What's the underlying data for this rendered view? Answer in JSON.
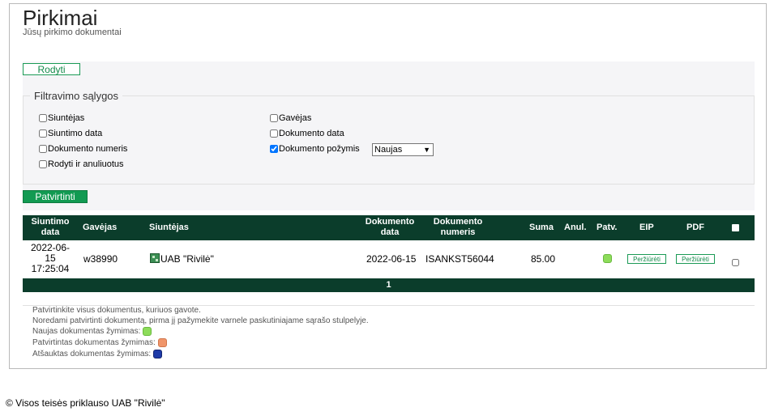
{
  "page": {
    "title": "Pirkimai",
    "subtitle": "Jūsų pirkimo dokumentai"
  },
  "buttons": {
    "show": "Rodyti",
    "confirm": "Patvirtinti"
  },
  "filters": {
    "legend": "Filtravimo sąlygos",
    "sender": {
      "label": "Siuntėjas",
      "checked": false
    },
    "sent_date": {
      "label": "Siuntimo data",
      "checked": false
    },
    "doc_number": {
      "label": "Dokumento numeris",
      "checked": false
    },
    "show_cancelled": {
      "label": "Rodyti ir anuliuotus",
      "checked": false
    },
    "receiver": {
      "label": "Gavėjas",
      "checked": false
    },
    "doc_date": {
      "label": "Dokumento data",
      "checked": false
    },
    "doc_feature": {
      "label": "Dokumento požymis",
      "checked": true,
      "selected": "Naujas"
    }
  },
  "table": {
    "headers": {
      "sent_date": [
        "Siuntimo",
        "data"
      ],
      "receiver": "Gavėjas",
      "sender": "Siuntėjas",
      "doc_date": [
        "Dokumento",
        "data"
      ],
      "doc_number": [
        "Dokumento",
        "numeris"
      ],
      "sum": "Suma",
      "cancelled": "Anul.",
      "confirmed": "Patv.",
      "eip": "EIP",
      "pdf": "PDF"
    },
    "rows": [
      {
        "sent_date": [
          "2022-06-",
          "15",
          "17:25:04"
        ],
        "receiver": "w38990",
        "sender": "UAB \"Rivilė\"",
        "sender_icon": "rivile-logo-icon",
        "doc_date": "2022-06-15",
        "doc_number": "ISANKST56044",
        "sum": "85.00",
        "cancelled": "",
        "status": "new",
        "eip_link": "Peržiūrėti",
        "pdf_link": "Peržiūrėti",
        "selected": false
      }
    ],
    "pager": "1"
  },
  "notes": {
    "line1": "Patvirtinkite visus dokumentus, kuriuos gavote.",
    "line2": "Noredami patvirtinti dokumentą, pirma jį pažymekite varnele paskutiniajame sąrašo stulpelyje.",
    "line3": "Naujas dokumentas žymimas:",
    "line4": "Patvirtintas dokumentas žymimas:",
    "line5": "Atšauktas dokumentas žymimas:"
  },
  "colors": {
    "new": "#8ddc5a",
    "confirmed": "#f0956a",
    "cancelled": "#1e3aa8",
    "accent": "#129a52",
    "header_bg": "#0b3d2b"
  },
  "footer": "© Visos teisės priklauso UAB \"Rivilė\""
}
